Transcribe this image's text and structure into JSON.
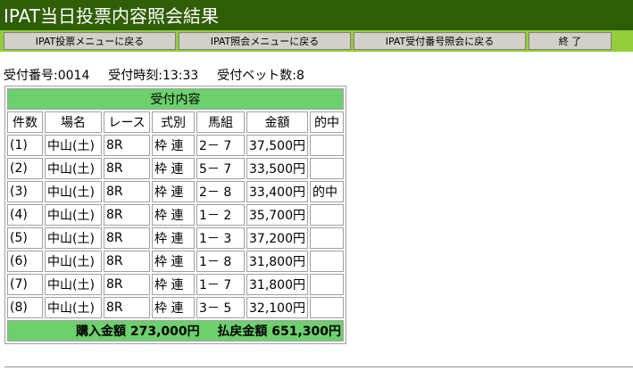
{
  "page": {
    "title": "IPAT当日投票内容照会結果"
  },
  "nav": {
    "buttons": [
      {
        "label": "IPAT投票メニューに戻る"
      },
      {
        "label": "IPAT照会メニューに戻る"
      },
      {
        "label": "IPAT受付番号照会に戻る"
      },
      {
        "label": "終 了"
      }
    ]
  },
  "summary": {
    "receipt_label": "受付番号:",
    "receipt_value": "0014",
    "time_label": "受付時刻:",
    "time_value": "13:33",
    "bets_label": "受付ベット数:",
    "bets_value": "8"
  },
  "table": {
    "caption": "受付内容",
    "headers": [
      "件数",
      "場名",
      "レース",
      "式別",
      "馬組",
      "金額",
      "的中"
    ],
    "rows": [
      {
        "num": "(1)",
        "place": "中山(土)",
        "race": "8R",
        "type": "枠 連",
        "combo": "2－ 7",
        "amount": "37,500円",
        "hit": ""
      },
      {
        "num": "(2)",
        "place": "中山(土)",
        "race": "8R",
        "type": "枠 連",
        "combo": "5－ 7",
        "amount": "33,500円",
        "hit": ""
      },
      {
        "num": "(3)",
        "place": "中山(土)",
        "race": "8R",
        "type": "枠 連",
        "combo": "2－ 8",
        "amount": "33,400円",
        "hit": "的中"
      },
      {
        "num": "(4)",
        "place": "中山(土)",
        "race": "8R",
        "type": "枠 連",
        "combo": "1－ 2",
        "amount": "35,700円",
        "hit": ""
      },
      {
        "num": "(5)",
        "place": "中山(土)",
        "race": "8R",
        "type": "枠 連",
        "combo": "1－ 3",
        "amount": "37,200円",
        "hit": ""
      },
      {
        "num": "(6)",
        "place": "中山(土)",
        "race": "8R",
        "type": "枠 連",
        "combo": "1－ 8",
        "amount": "31,800円",
        "hit": ""
      },
      {
        "num": "(7)",
        "place": "中山(土)",
        "race": "8R",
        "type": "枠 連",
        "combo": "1－ 7",
        "amount": "31,800円",
        "hit": ""
      },
      {
        "num": "(8)",
        "place": "中山(土)",
        "race": "8R",
        "type": "枠 連",
        "combo": "3－ 5",
        "amount": "32,100円",
        "hit": ""
      }
    ],
    "total_purchase_label": "購入金額",
    "total_purchase_value": "273,000円",
    "total_payout_label": "払戻金額",
    "total_payout_value": "651,300円"
  },
  "colors": {
    "title_bg": "#2f5e04",
    "nav_bg": "#94cc3a",
    "header_green": "#6cd06c",
    "button_gray": "#d4d0c8"
  }
}
